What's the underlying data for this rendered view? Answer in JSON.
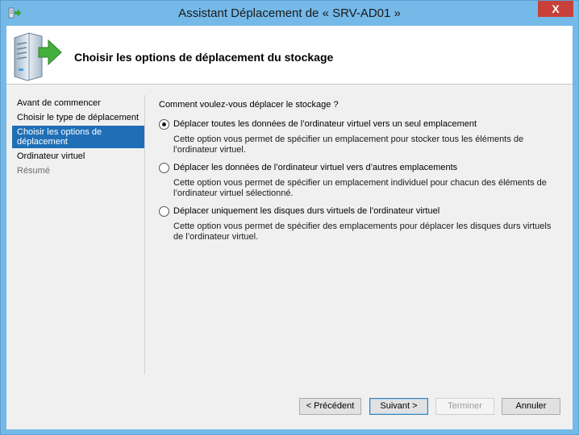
{
  "window": {
    "title": "Assistant Déplacement de « SRV-AD01 »",
    "close_label": "X"
  },
  "header": {
    "title": "Choisir les options de déplacement du stockage"
  },
  "nav": {
    "items": [
      {
        "label": "Avant de commencer",
        "state": "normal"
      },
      {
        "label": "Choisir le type de déplacement",
        "state": "normal"
      },
      {
        "label": "Choisir les options de déplacement",
        "state": "active"
      },
      {
        "label": "Ordinateur virtuel",
        "state": "normal"
      },
      {
        "label": "Résumé",
        "state": "disabled"
      }
    ]
  },
  "content": {
    "question": "Comment voulez-vous déplacer le stockage ?",
    "options": [
      {
        "label": "Déplacer toutes les données de l’ordinateur virtuel vers un seul emplacement",
        "description": "Cette option vous permet de spécifier un emplacement pour stocker tous les éléments de l’ordinateur virtuel.",
        "checked": true
      },
      {
        "label": "Déplacer les données de l’ordinateur virtuel vers d’autres emplacements",
        "description": "Cette option vous permet de spécifier un emplacement individuel pour chacun des éléments de l’ordinateur virtuel sélectionné.",
        "checked": false
      },
      {
        "label": "Déplacer uniquement les disques durs virtuels de l’ordinateur virtuel",
        "description": "Cette option vous permet de spécifier des emplacements pour déplacer les disques durs virtuels de l’ordinateur virtuel.",
        "checked": false
      }
    ]
  },
  "footer": {
    "previous_label": "< Précédent",
    "next_label": "Suivant >",
    "finish_label": "Terminer",
    "cancel_label": "Annuler"
  }
}
